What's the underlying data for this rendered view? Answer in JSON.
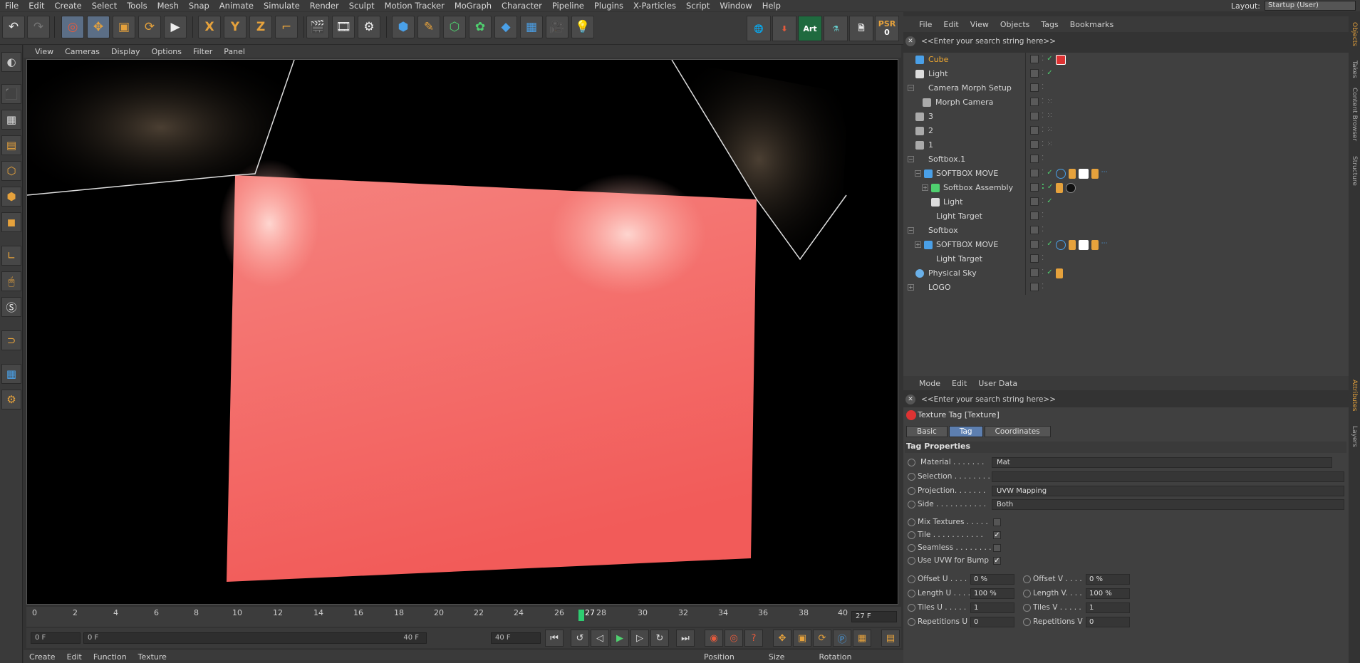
{
  "menu": [
    "File",
    "Edit",
    "Create",
    "Select",
    "Tools",
    "Mesh",
    "Snap",
    "Animate",
    "Simulate",
    "Render",
    "Sculpt",
    "Motion Tracker",
    "MoGraph",
    "Character",
    "Pipeline",
    "Plugins",
    "X-Particles",
    "Script",
    "Window",
    "Help"
  ],
  "layout": {
    "label": "Layout:",
    "value": "Startup (User)"
  },
  "toolbar": {
    "x": "X",
    "y": "Y",
    "z": "Z",
    "art": "Art",
    "psr": "PSR",
    "psr_val": "0"
  },
  "viewport_menu": [
    "View",
    "Cameras",
    "Display",
    "Options",
    "Filter",
    "Panel"
  ],
  "timeline": {
    "ticks": [
      "0",
      "2",
      "4",
      "6",
      "8",
      "10",
      "12",
      "14",
      "16",
      "18",
      "20",
      "22",
      "24",
      "26",
      "28",
      "30",
      "32",
      "34",
      "36",
      "38",
      "40"
    ],
    "current": "27",
    "frame_field": "27 F"
  },
  "transport": {
    "start": "0 F",
    "range_start": "0 F",
    "range_end": "40 F",
    "end": "40 F"
  },
  "bottom_menu": [
    "Create",
    "Edit",
    "Function",
    "Texture"
  ],
  "coords_header": [
    "Position",
    "Size",
    "Rotation"
  ],
  "object_manager": {
    "menu": [
      "File",
      "Edit",
      "View",
      "Objects",
      "Tags",
      "Bookmarks"
    ],
    "search_placeholder": "<<Enter your search string here>>",
    "rows": [
      {
        "name": "Cube",
        "indent": 0,
        "selected": true
      },
      {
        "name": "Light",
        "indent": 0
      },
      {
        "name": "Camera Morph Setup",
        "indent": 0
      },
      {
        "name": "Morph Camera",
        "indent": 1
      },
      {
        "name": "3",
        "indent": 0
      },
      {
        "name": "2",
        "indent": 0
      },
      {
        "name": "1",
        "indent": 0
      },
      {
        "name": "Softbox.1",
        "indent": 0
      },
      {
        "name": "SOFTBOX MOVE",
        "indent": 1
      },
      {
        "name": "Softbox Assembly",
        "indent": 2
      },
      {
        "name": "Light",
        "indent": 3
      },
      {
        "name": "Light Target",
        "indent": 1
      },
      {
        "name": "Softbox",
        "indent": 0
      },
      {
        "name": "SOFTBOX MOVE",
        "indent": 1
      },
      {
        "name": "Light Target",
        "indent": 1
      },
      {
        "name": "Physical Sky",
        "indent": 0
      },
      {
        "name": "LOGO",
        "indent": 0
      }
    ]
  },
  "attributes": {
    "menu": [
      "Mode",
      "Edit",
      "User Data"
    ],
    "search_placeholder": "<<Enter your search string here>>",
    "title": "Texture Tag [Texture]",
    "tabs": [
      "Basic",
      "Tag",
      "Coordinates"
    ],
    "section": "Tag Properties",
    "props": {
      "material": {
        "label": "Material . . . . . . .",
        "value": "Mat"
      },
      "selection": {
        "label": "Selection . . . . . . . .",
        "value": ""
      },
      "projection": {
        "label": "Projection. . . . . . .",
        "value": "UVW Mapping"
      },
      "side": {
        "label": "Side . . . . . . . . . . .",
        "value": "Both"
      },
      "mix": {
        "label": "Mix Textures . . . . ."
      },
      "tile": {
        "label": "Tile . . . . . . . . . . ."
      },
      "seamless": {
        "label": "Seamless . . . . . . . ."
      },
      "uvwbump": {
        "label": "Use UVW for Bump"
      }
    },
    "offset_u": {
      "label": "Offset U . . . .",
      "value": "0 %"
    },
    "offset_v": {
      "label": "Offset V . . . .",
      "value": "0 %"
    },
    "length_u": {
      "label": "Length U . . . .",
      "value": "100 %"
    },
    "length_v": {
      "label": "Length V. . . .",
      "value": "100 %"
    },
    "tiles_u": {
      "label": "Tiles U . . . . .",
      "value": "1"
    },
    "tiles_v": {
      "label": "Tiles V . . . . .",
      "value": "1"
    },
    "rep_u": {
      "label": "Repetitions U",
      "value": "0"
    },
    "rep_v": {
      "label": "Repetitions V",
      "value": "0"
    }
  },
  "side_tabs": [
    "Objects",
    "Takes",
    "Content Browser",
    "Structure"
  ],
  "side_tabs_lower": [
    "Attributes",
    "Layers"
  ]
}
